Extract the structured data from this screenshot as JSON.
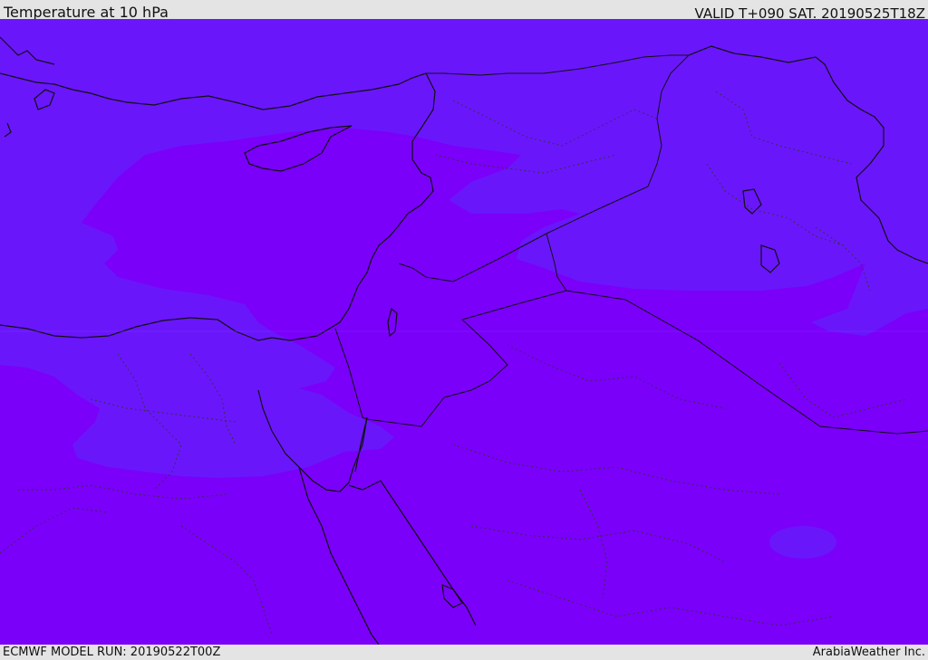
{
  "header": {
    "title": "Temperature at 10 hPa",
    "valid_time": "VALID T+090 SAT. 20190525T18Z"
  },
  "footer": {
    "model_run": "ECMWF MODEL RUN: 20190522T00Z",
    "credit": "ArabiaWeather Inc."
  },
  "map": {
    "region": "Eastern Mediterranean / Middle East",
    "colors": {
      "warmer_band": "#6a16fb",
      "colder_band": "#7a00f9",
      "coastline": "#111111",
      "border": "#111111",
      "admin_border": "#333333"
    }
  }
}
